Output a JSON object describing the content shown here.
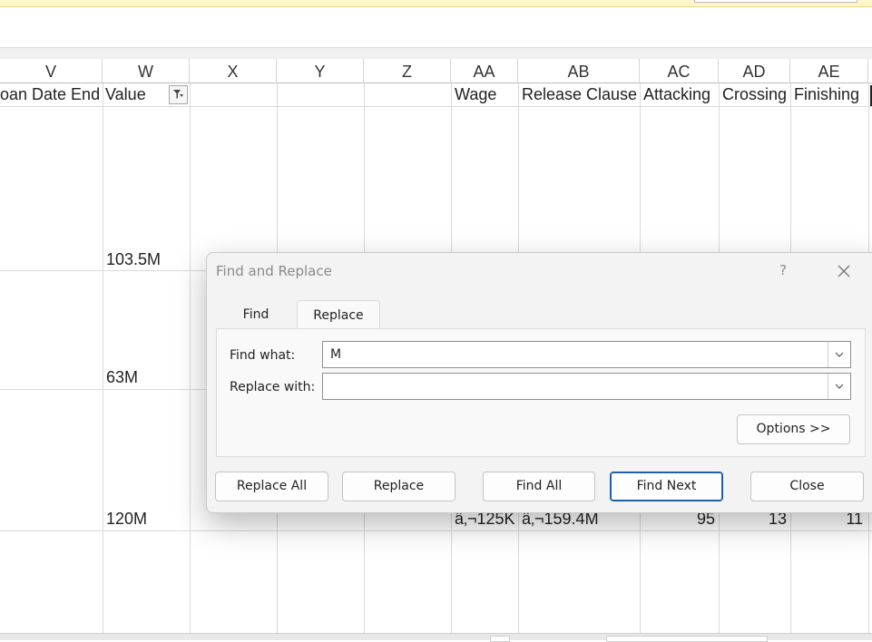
{
  "columns": [
    {
      "letter": "V",
      "header": "oan Date End"
    },
    {
      "letter": "W",
      "header": "Value"
    },
    {
      "letter": "X",
      "header": ""
    },
    {
      "letter": "Y",
      "header": ""
    },
    {
      "letter": "Z",
      "header": ""
    },
    {
      "letter": "AA",
      "header": "Wage"
    },
    {
      "letter": "AB",
      "header": "Release Clause"
    },
    {
      "letter": "AC",
      "header": "Attacking"
    },
    {
      "letter": "AD",
      "header": "Crossing"
    },
    {
      "letter": "AE",
      "header": "Finishing"
    }
  ],
  "cells": {
    "value_row1": "103.5M",
    "value_row2": "63M",
    "value_row3": "120M",
    "wage_row3": "â‚¬125K",
    "release_row3": "â‚¬159.4M",
    "attacking_row3": "95",
    "crossing_row3": "13",
    "finishing_row3": "11"
  },
  "dialog": {
    "title": "Find and Replace",
    "help": "?",
    "tabs": {
      "find": "Find",
      "replace": "Replace"
    },
    "find_what_label": "Find what:",
    "find_what_value": "M",
    "replace_with_label": "Replace with:",
    "replace_with_value": "",
    "options_label": "Options >>",
    "buttons": {
      "replace_all": "Replace All",
      "replace": "Replace",
      "find_all": "Find All",
      "find_next": "Find Next",
      "close": "Close"
    }
  },
  "colors": {
    "accent": "#1f5fa8",
    "top_bar": "#fdf6c8"
  }
}
